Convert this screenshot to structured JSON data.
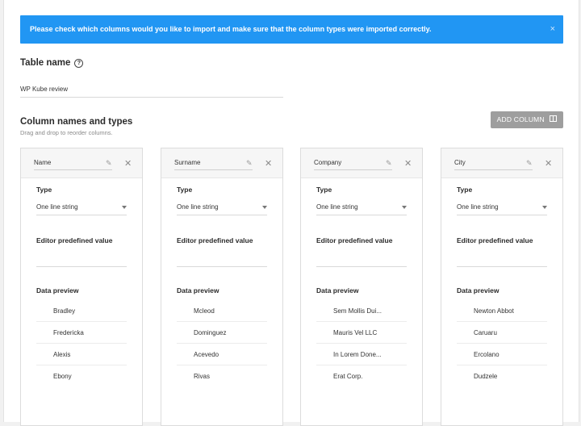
{
  "notice": {
    "text": "Please check which columns would you like to import and make sure that the column types were imported correctly.",
    "close_icon": "×"
  },
  "table_name": {
    "label": "Table name",
    "help_icon": "?",
    "value": "WP Kube review"
  },
  "columns_section": {
    "title": "Column names and types",
    "subtitle": "Drag and drop to reorder columns.",
    "add_button": "ADD COLUMN"
  },
  "labels": {
    "type": "Type",
    "editor_value": "Editor predefined value",
    "data_preview": "Data preview"
  },
  "columns": [
    {
      "name": "Name",
      "type": "One line string",
      "preview": [
        "Bradley",
        "Fredericka",
        "Alexis",
        "Ebony"
      ]
    },
    {
      "name": "Surname",
      "type": "One line string",
      "preview": [
        "Mcleod",
        "Dominguez",
        "Acevedo",
        "Rivas"
      ]
    },
    {
      "name": "Company",
      "type": "One line string",
      "preview": [
        "Sem Mollis Dui...",
        "Mauris Vel LLC",
        "In Lorem Done...",
        "Erat Corp."
      ]
    },
    {
      "name": "City",
      "type": "One line string",
      "preview": [
        "Newton Abbot",
        "Caruaru",
        "Ercolano",
        "Dudzele"
      ]
    }
  ]
}
